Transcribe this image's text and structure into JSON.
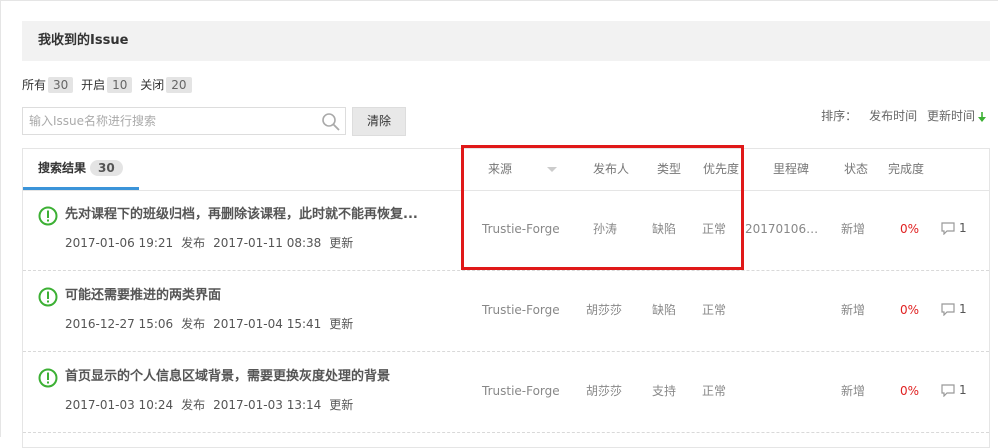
{
  "page_title": "我收到的Issue",
  "filters": [
    {
      "label": "所有",
      "count": "30"
    },
    {
      "label": "开启",
      "count": "10"
    },
    {
      "label": "关闭",
      "count": "20"
    }
  ],
  "search": {
    "placeholder": "输入Issue名称进行搜索",
    "clear_label": "清除"
  },
  "sort": {
    "label": "排序：",
    "options": [
      "发布时间",
      "更新时间"
    ]
  },
  "results_tab": {
    "label": "搜索结果",
    "count": "30"
  },
  "columns": [
    "来源",
    "发布人",
    "类型",
    "优先度",
    "里程碑",
    "状态",
    "完成度"
  ],
  "issues": [
    {
      "title": "先对课程下的班级归档，再删除该课程，此时就不能再恢复...",
      "published_time": "2017-01-06 19:21",
      "published_label": "发布",
      "updated_time": "2017-01-11 08:38",
      "updated_label": "更新",
      "source": "Trustie-Forge",
      "author": "孙涛",
      "type": "缺陷",
      "priority": "正常",
      "milestone": "20170106周...",
      "status": "新增",
      "done": "0%",
      "comments": "1"
    },
    {
      "title": "可能还需要推进的两类界面",
      "published_time": "2016-12-27 15:06",
      "published_label": "发布",
      "updated_time": "2017-01-04 15:41",
      "updated_label": "更新",
      "source": "Trustie-Forge",
      "author": "胡莎莎",
      "type": "缺陷",
      "priority": "正常",
      "milestone": "",
      "status": "新增",
      "done": "0%",
      "comments": "1"
    },
    {
      "title": "首页显示的个人信息区域背景，需要更换灰度处理的背景",
      "published_time": "2017-01-03 10:24",
      "published_label": "发布",
      "updated_time": "2017-01-03 13:14",
      "updated_label": "更新",
      "source": "Trustie-Forge",
      "author": "胡莎莎",
      "type": "支持",
      "priority": "正常",
      "milestone": "",
      "status": "新增",
      "done": "0%",
      "comments": "1"
    }
  ],
  "colors": {
    "accent_blue": "#3b94d9",
    "status_green": "#3cb034",
    "done_red": "#e02020",
    "highlight_red": "#e01818",
    "sort_arrow_green": "#3cb034"
  },
  "icons": {
    "status": "open-issue-icon",
    "search": "search-icon",
    "comment": "comment-icon",
    "sort": "arrow-down-icon"
  }
}
